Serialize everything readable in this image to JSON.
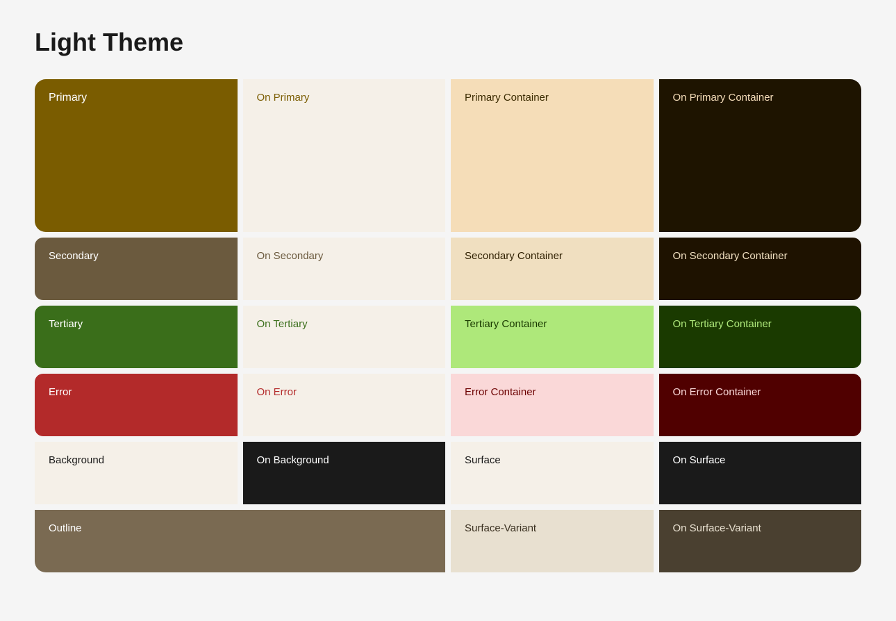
{
  "title": "Light Theme",
  "rows": [
    {
      "cells": [
        {
          "name": "primary",
          "label": "Primary",
          "bg": "#7a5c00",
          "fg": "#ffffff",
          "type": "cell-primary"
        },
        {
          "name": "on-primary",
          "label": "On Primary",
          "bg": "#f5f0e8",
          "fg": "#7a5c00",
          "type": "cell-on-primary"
        },
        {
          "name": "primary-container",
          "label": "Primary Container",
          "bg": "#f5ddb8",
          "fg": "#3a2a00",
          "type": "cell-primary-container"
        },
        {
          "name": "on-primary-container",
          "label": "On Primary Container",
          "bg": "#1e1400",
          "fg": "#f5ddb8",
          "type": "cell-on-primary-container"
        }
      ]
    },
    {
      "cells": [
        {
          "name": "secondary",
          "label": "Secondary",
          "bg": "#6b5a3e",
          "fg": "#ffffff",
          "type": "cell-secondary"
        },
        {
          "name": "on-secondary",
          "label": "On Secondary",
          "bg": "#f5f0e8",
          "fg": "#6b5a3e",
          "type": "cell-on-secondary"
        },
        {
          "name": "secondary-container",
          "label": "Secondary Container",
          "bg": "#f0dfc0",
          "fg": "#2e1f00",
          "type": "cell-secondary-container"
        },
        {
          "name": "on-secondary-container",
          "label": "On Secondary Container",
          "bg": "#1e1200",
          "fg": "#f0dfc0",
          "type": "cell-on-secondary-container"
        }
      ]
    },
    {
      "cells": [
        {
          "name": "tertiary",
          "label": "Tertiary",
          "bg": "#3a6e1a",
          "fg": "#ffffff",
          "type": "cell-tertiary"
        },
        {
          "name": "on-tertiary",
          "label": "On Tertiary",
          "bg": "#f5f0e8",
          "fg": "#3a6e1a",
          "type": "cell-on-tertiary"
        },
        {
          "name": "tertiary-container",
          "label": "Tertiary Container",
          "bg": "#aee87a",
          "fg": "#1a3a00",
          "type": "cell-tertiary-container"
        },
        {
          "name": "on-tertiary-container",
          "label": "On Tertiary Container",
          "bg": "#1a3a00",
          "fg": "#aee87a",
          "type": "cell-on-tertiary-container"
        }
      ]
    },
    {
      "cells": [
        {
          "name": "error",
          "label": "Error",
          "bg": "#b32a2a",
          "fg": "#ffffff",
          "type": "cell-error"
        },
        {
          "name": "on-error",
          "label": "On Error",
          "bg": "#f5f0e8",
          "fg": "#b32a2a",
          "type": "cell-on-error"
        },
        {
          "name": "error-container",
          "label": "Error Container",
          "bg": "#fad8d8",
          "fg": "#6b0000",
          "type": "cell-error-container"
        },
        {
          "name": "on-error-container",
          "label": "On Error Container",
          "bg": "#500000",
          "fg": "#fad8d8",
          "type": "cell-on-error-container"
        }
      ]
    },
    {
      "cells": [
        {
          "name": "background",
          "label": "Background",
          "bg": "#f5f0e8",
          "fg": "#1a1a1a",
          "type": "cell-background"
        },
        {
          "name": "on-background",
          "label": "On Background",
          "bg": "#1a1a1a",
          "fg": "#ffffff",
          "type": "cell-on-background"
        },
        {
          "name": "surface",
          "label": "Surface",
          "bg": "#f5f0e8",
          "fg": "#1a1a1a",
          "type": "cell-surface"
        },
        {
          "name": "on-surface",
          "label": "On Surface",
          "bg": "#1a1a1a",
          "fg": "#ffffff",
          "type": "cell-on-surface"
        }
      ]
    },
    {
      "cells": [
        {
          "name": "outline",
          "label": "Outline",
          "bg": "#7a6a52",
          "fg": "#ffffff",
          "type": "cell-outline",
          "span": 2
        },
        {
          "name": "surface-variant",
          "label": "Surface-Variant",
          "bg": "#e8e0d0",
          "fg": "#3a3020",
          "type": "cell-surface-variant"
        },
        {
          "name": "on-surface-variant",
          "label": "On Surface-Variant",
          "bg": "#4a4030",
          "fg": "#e8e0d0",
          "type": "cell-on-surface-variant"
        }
      ]
    }
  ]
}
